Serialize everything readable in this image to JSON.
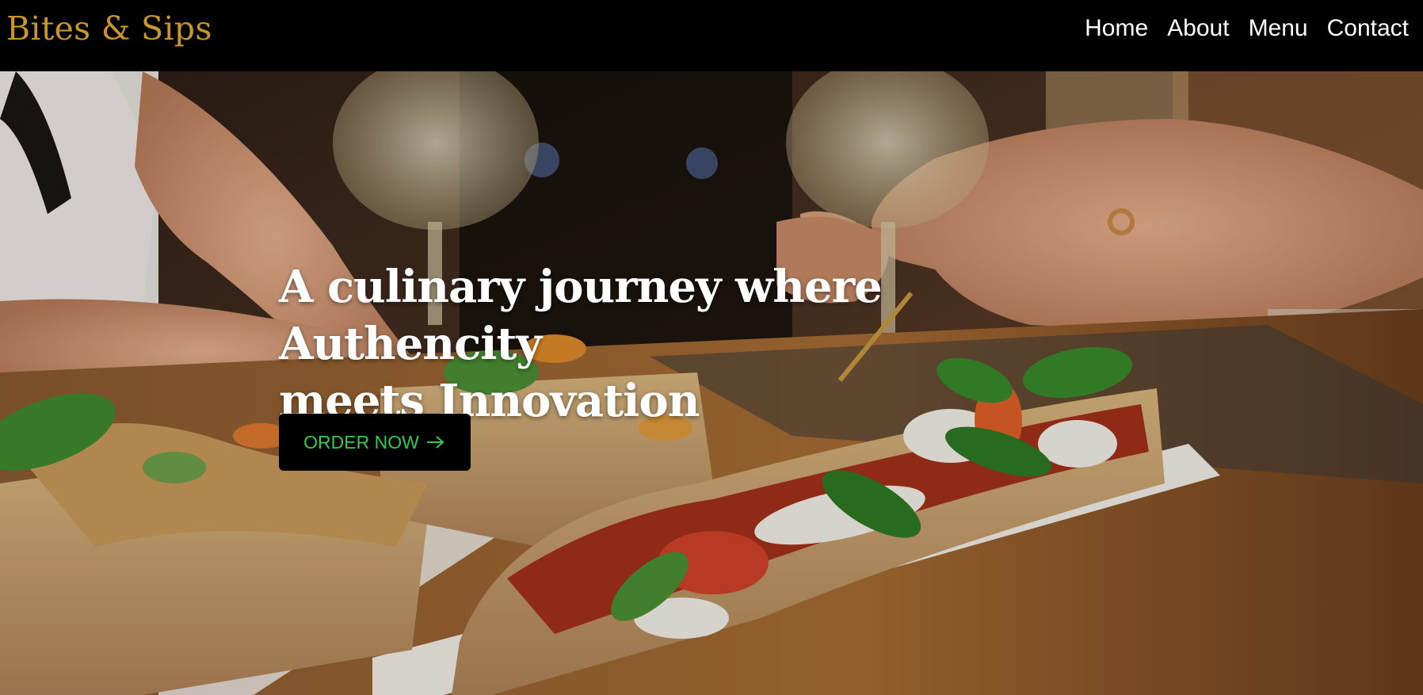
{
  "brand": {
    "name": "Bites & Sips",
    "color": "#c8962a"
  },
  "nav": {
    "items": [
      {
        "label": "Home"
      },
      {
        "label": "About"
      },
      {
        "label": "Menu"
      },
      {
        "label": "Contact"
      }
    ]
  },
  "hero": {
    "title_line1": "A culinary journey where Authencity",
    "title_line2": "meets Innovation",
    "cta": {
      "label": "ORDER NOW",
      "icon": "arrow-right-icon",
      "color": "#37c84f"
    },
    "image": "photo of pinsa slices with basil, mozzarella and wine glasses on a wooden table"
  }
}
